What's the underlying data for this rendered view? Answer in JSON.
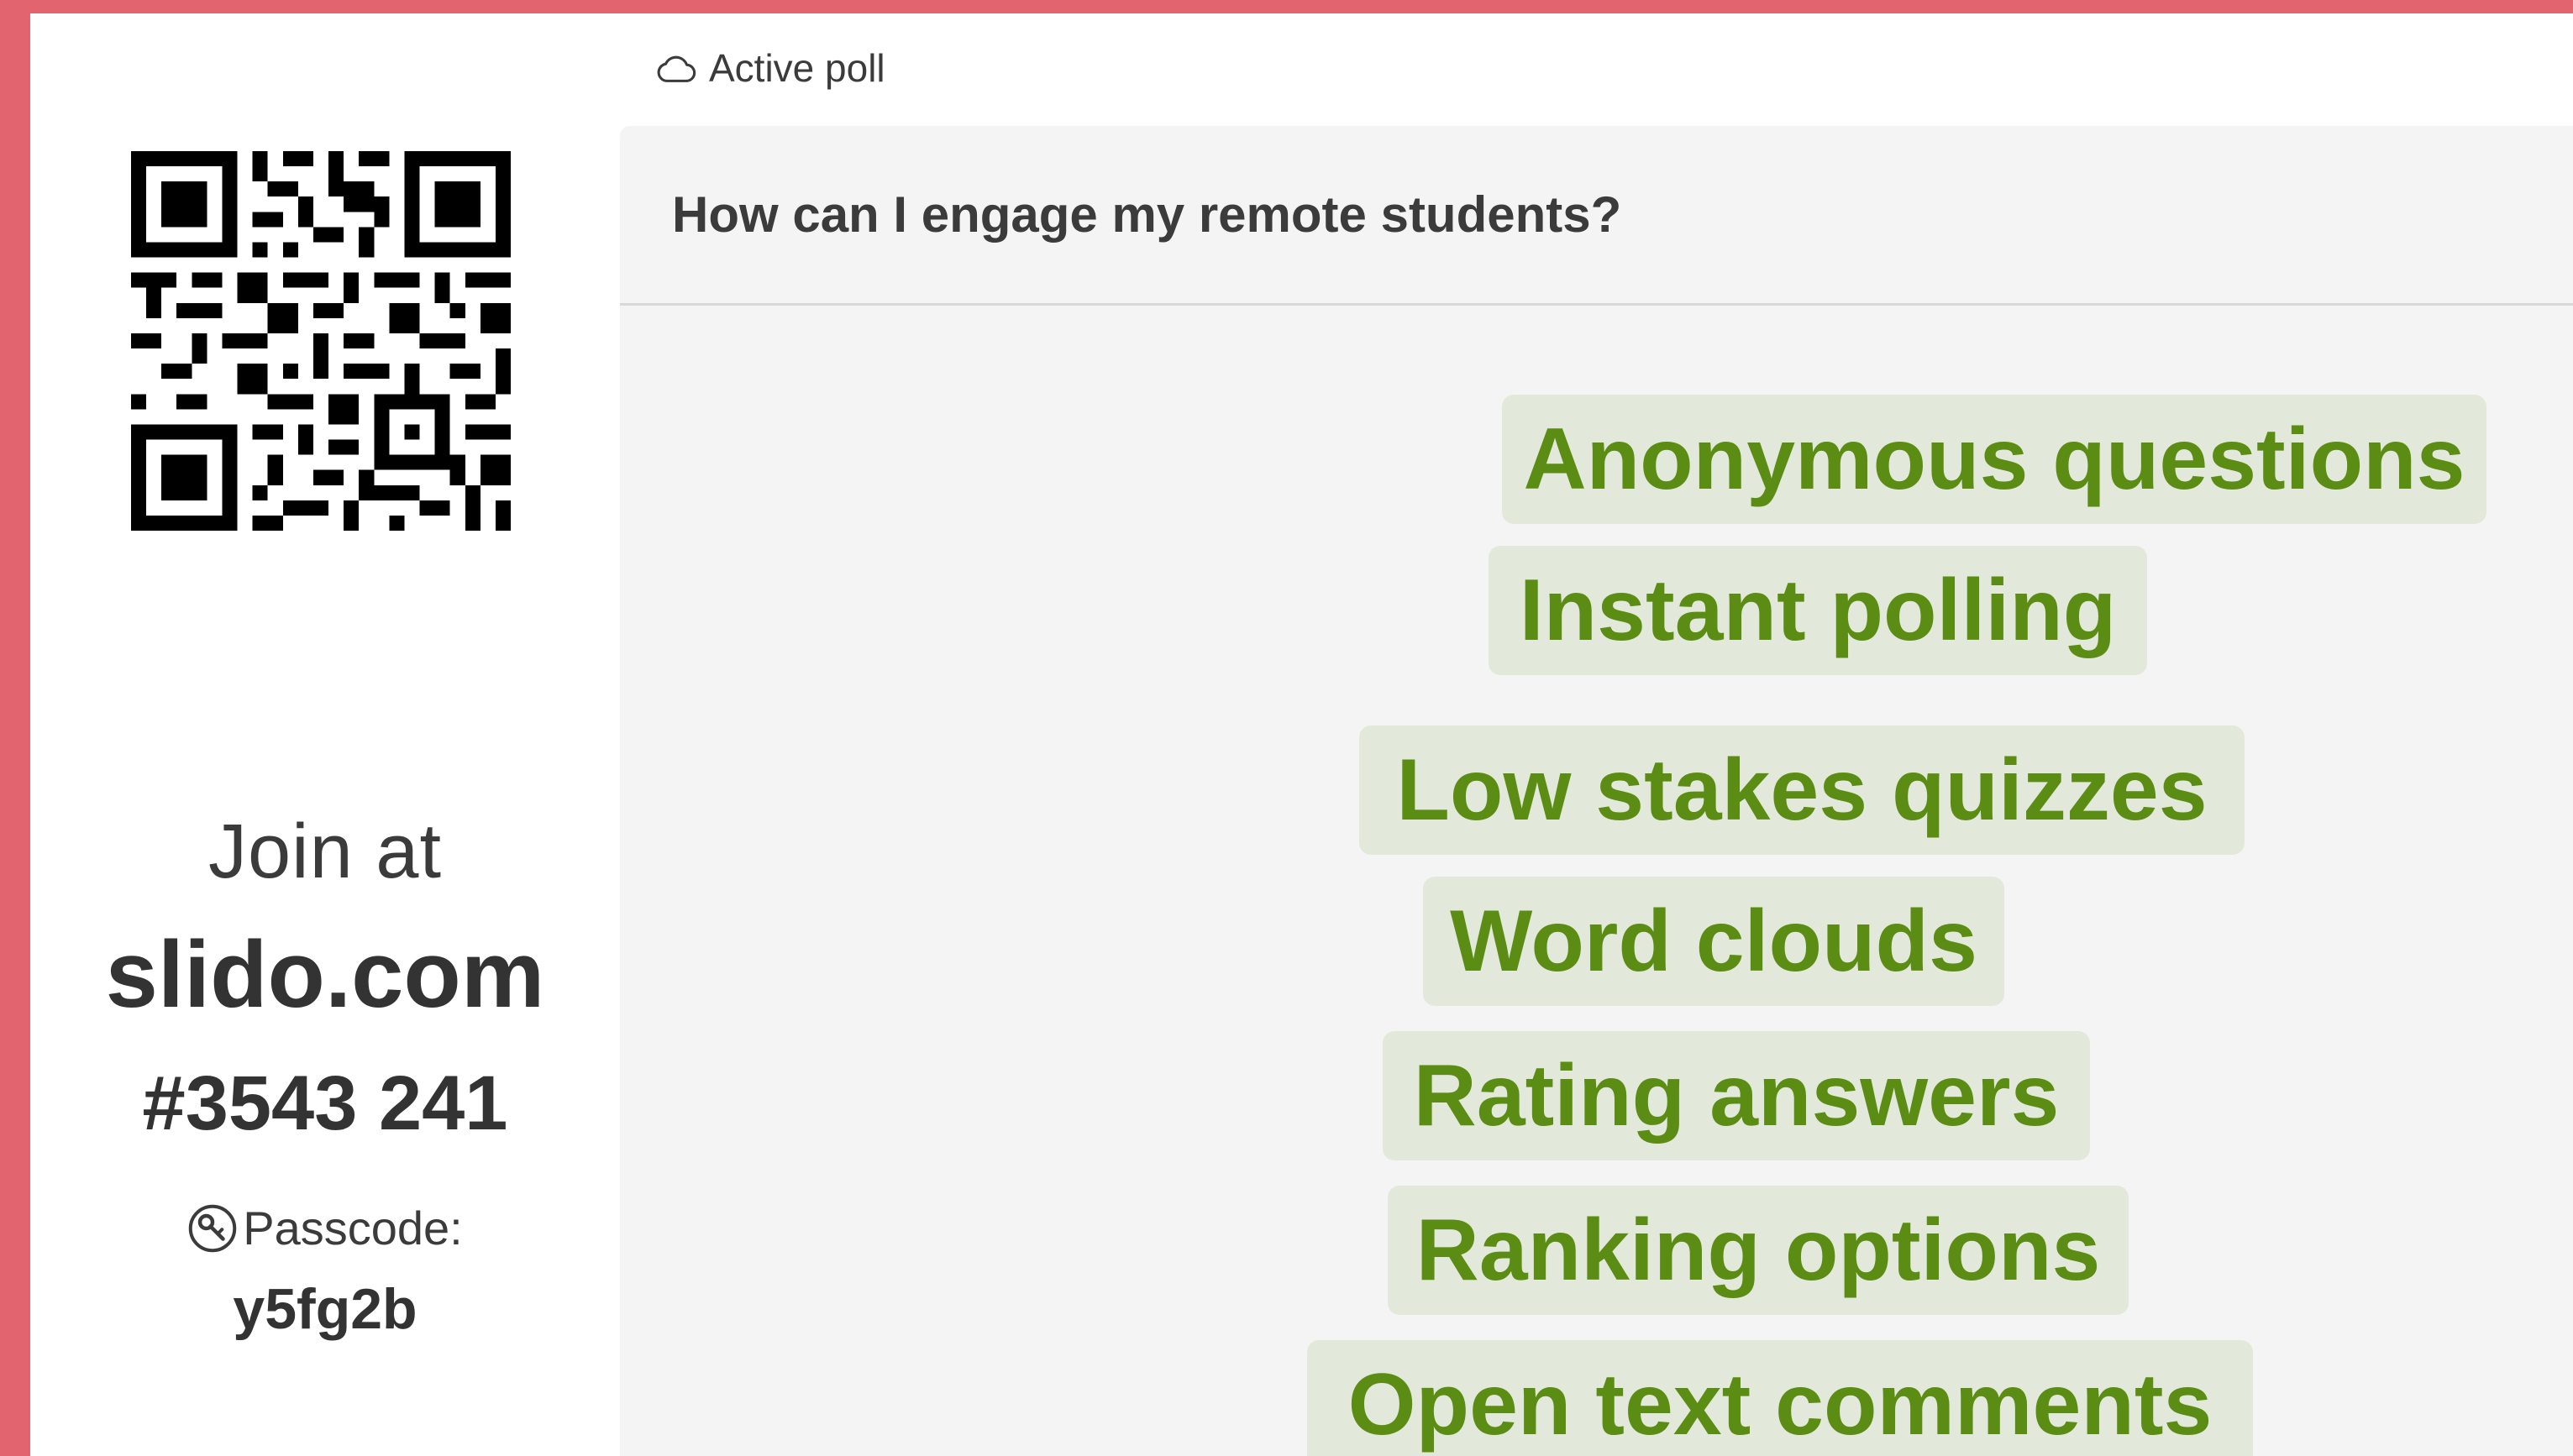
{
  "status": {
    "icon": "cloud-icon",
    "label": "Active poll"
  },
  "sidebar": {
    "qr_icon": "qr-code-icon",
    "join_label": "Join at",
    "join_url": "slido.com",
    "event_code": "#3543 241",
    "passcode_icon": "key-icon",
    "passcode_label": "Passcode:",
    "passcode_value": "y5fg2b"
  },
  "poll": {
    "question": "How can I engage my remote students?",
    "answers": [
      "Anonymous questions",
      "Instant polling",
      "Low stakes quizzes",
      "Word clouds",
      "Rating answers",
      "Ranking options",
      "Open text comments"
    ]
  },
  "colors": {
    "accent_border": "#e2646f",
    "answer_text": "#5b8c13",
    "answer_bg": "#e3e9da",
    "panel_bg": "#f4f4f4"
  }
}
